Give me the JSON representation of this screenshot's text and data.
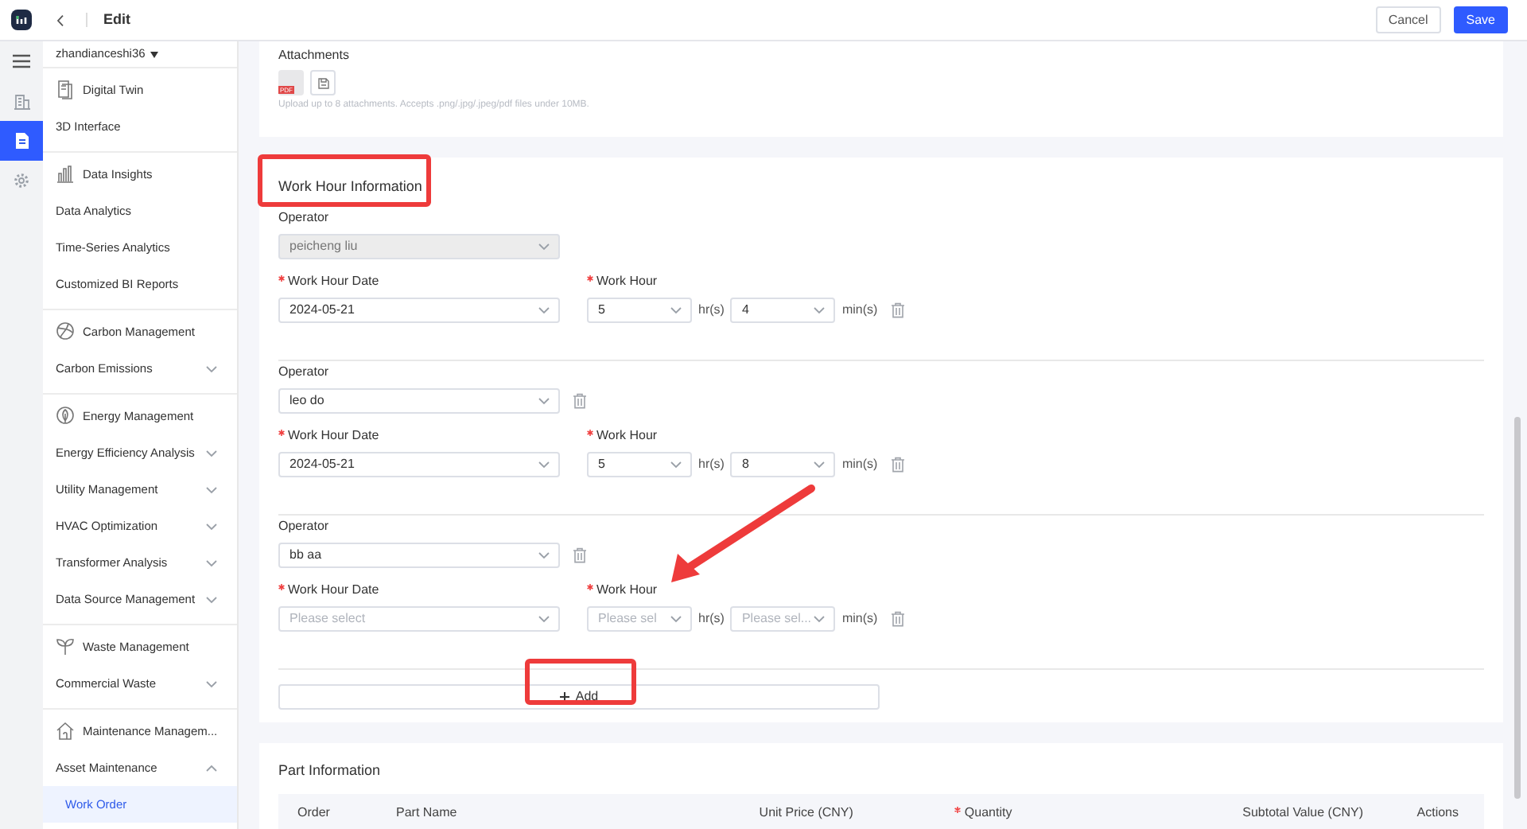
{
  "header": {
    "title": "Edit",
    "buttons": [
      {
        "label": "Cancel",
        "kind": "secondary"
      },
      {
        "label": "Save",
        "kind": "primary"
      }
    ]
  },
  "rail": [
    {
      "kind": "menu",
      "selected": false
    },
    {
      "kind": "building",
      "selected": false
    },
    {
      "kind": "document",
      "selected": true
    },
    {
      "kind": "settings",
      "selected": false
    }
  ],
  "sidebar": {
    "user": "zhandianceshi36",
    "groups": [
      {
        "title": "Digital Twin",
        "items": [
          {
            "label": "3D Interface",
            "kind": "link",
            "selected": false
          }
        ]
      },
      {
        "title": "Data Insights",
        "items": [
          {
            "label": "Data Analytics",
            "kind": "link",
            "selected": false
          },
          {
            "label": "Time-Series Analytics",
            "kind": "link",
            "selected": false
          },
          {
            "label": "Customized BI Reports",
            "kind": "link",
            "selected": false
          }
        ]
      },
      {
        "title": "Carbon Management",
        "items": [
          {
            "label": "Carbon Emissions",
            "kind": "menu",
            "expanded": false,
            "selected": false
          }
        ]
      },
      {
        "title": "Energy Management",
        "items": [
          {
            "label": "Energy Efficiency Analysis",
            "kind": "menu",
            "expanded": false,
            "selected": false
          },
          {
            "label": "Utility Management",
            "kind": "menu",
            "expanded": false,
            "selected": false
          },
          {
            "label": "HVAC Optimization",
            "kind": "menu",
            "expanded": false,
            "selected": false
          },
          {
            "label": "Transformer Analysis",
            "kind": "menu",
            "expanded": false,
            "selected": false
          },
          {
            "label": "Data Source Management",
            "kind": "menu",
            "expanded": false,
            "selected": false
          }
        ]
      },
      {
        "title": "Waste Management",
        "items": [
          {
            "label": "Commercial Waste",
            "kind": "menu",
            "expanded": false,
            "selected": false
          }
        ]
      },
      {
        "title": "Maintenance Managem...",
        "items": [
          {
            "label": "Asset Maintenance",
            "kind": "menu",
            "expanded": true,
            "selected": false,
            "children": [
              {
                "label": "Work Order",
                "selected": true
              }
            ]
          }
        ]
      }
    ]
  },
  "attachments": {
    "label": "Attachments",
    "file_badge": "PDF",
    "hint": "Upload up to 8 attachments. Accepts .png/.jpg/.jpeg/pdf files under 10MB."
  },
  "work_hours": {
    "title": "Work Hour Information",
    "entries": [
      {
        "operator_label": {
          "text": "Operator",
          "required": false
        },
        "operator": {
          "value": "peicheng liu",
          "disabled": true
        },
        "removable": false,
        "date_label": {
          "text": "Work Hour Date",
          "required": true
        },
        "date": {
          "value": "2024-05-21"
        },
        "hour_label": {
          "text": "Work Hour",
          "required": true
        },
        "hours": {
          "value": "5"
        },
        "hours_unit": "hr(s)",
        "minutes": {
          "value": "4"
        },
        "minutes_unit": "min(s)"
      },
      {
        "operator_label": {
          "text": "Operator",
          "required": false
        },
        "operator": {
          "value": "leo do",
          "disabled": false
        },
        "removable": true,
        "date_label": {
          "text": "Work Hour Date",
          "required": true
        },
        "date": {
          "value": "2024-05-21"
        },
        "hour_label": {
          "text": "Work Hour",
          "required": true
        },
        "hours": {
          "value": "5"
        },
        "hours_unit": "hr(s)",
        "minutes": {
          "value": "8"
        },
        "minutes_unit": "min(s)"
      },
      {
        "operator_label": {
          "text": "Operator",
          "required": false
        },
        "operator": {
          "value": "bb aa",
          "disabled": false
        },
        "removable": true,
        "date_label": {
          "text": "Work Hour Date",
          "required": true
        },
        "date": {
          "placeholder": "Please select"
        },
        "hour_label": {
          "text": "Work Hour",
          "required": true
        },
        "hours": {
          "placeholder": "Please sel"
        },
        "hours_unit": "hr(s)",
        "minutes": {
          "placeholder": "Please sel..."
        },
        "minutes_unit": "min(s)"
      }
    ],
    "add_button": "Add"
  },
  "parts": {
    "title": "Part Information",
    "columns": [
      {
        "label": "Order",
        "required": false
      },
      {
        "label": "Part Name",
        "required": false
      },
      {
        "label": "Unit Price (CNY)",
        "required": false
      },
      {
        "label": "Quantity",
        "required": true
      },
      {
        "label": "Subtotal Value (CNY)",
        "required": false
      },
      {
        "label": "Actions",
        "required": false
      }
    ]
  }
}
